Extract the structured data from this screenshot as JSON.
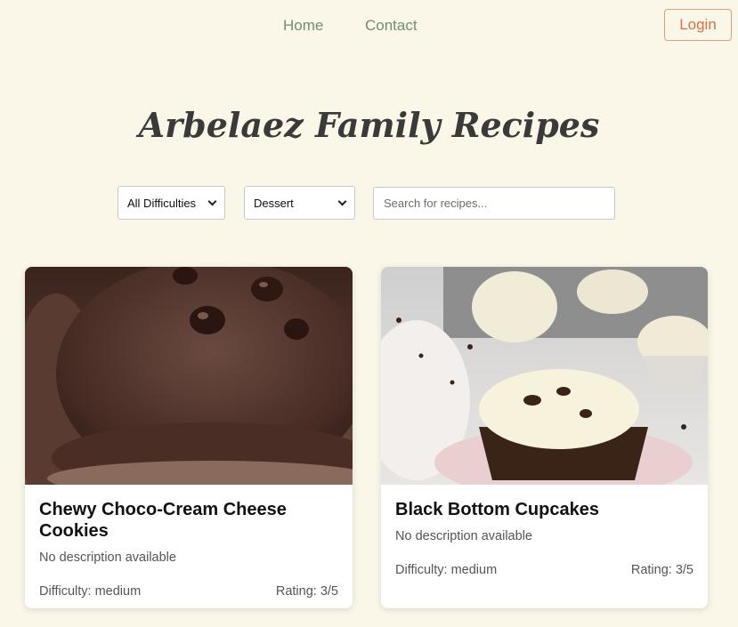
{
  "nav": {
    "home_label": "Home",
    "contact_label": "Contact",
    "login_label": "Login"
  },
  "page": {
    "title": "Arbelaez Family Recipes"
  },
  "filters": {
    "difficulty_selected": "All Difficulties",
    "category_selected": "Dessert",
    "search_placeholder": "Search for recipes..."
  },
  "recipes": [
    {
      "title": "Chewy Choco-Cream Cheese Cookies",
      "description": "No description available",
      "difficulty": "Difficulty: medium",
      "rating": "Rating: 3/5",
      "image": "chocolate-cookie-photo"
    },
    {
      "title": "Black Bottom Cupcakes",
      "description": "No description available",
      "difficulty": "Difficulty: medium",
      "rating": "Rating: 3/5",
      "image": "cupcake-photo"
    }
  ],
  "colors": {
    "background": "#faf7e8",
    "nav_link": "#6f8f76",
    "login_accent": "#d5714a"
  }
}
